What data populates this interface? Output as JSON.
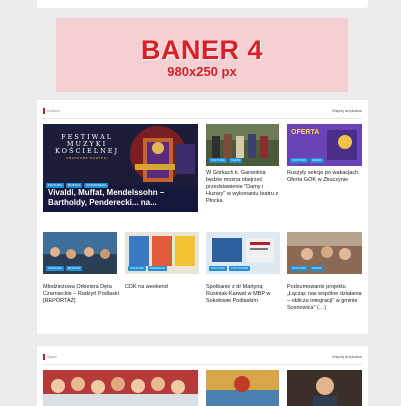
{
  "banner": {
    "title": "BANER 4",
    "size": "980x250 px"
  },
  "section1": {
    "label": "Kultura",
    "more": "Więcej artykułów"
  },
  "feature": {
    "title": "Vivaldi, Muffat, Mendelssohn – Bartholdy, Penderecki... na...",
    "poster_line1": "FESTIWAL",
    "poster_line2": "MUZYKI",
    "poster_line3": "KOŚCIELNEJ",
    "poster_sub": "GRZEGORZ NOWICKI",
    "badges": [
      "KULTURA",
      "MUZYKA",
      "WYDARZENIA"
    ]
  },
  "side_articles": [
    {
      "title": "W Górkach k. Garwolina będzie można obejrzeć przedstawienie \"Damy i Huzary\" w wykonaniu teatru z Płocka",
      "badges": [
        "KULTURA",
        "TEATR"
      ]
    },
    {
      "title": "Ruszyły sekcje po wakacjach. Oferta GOK w Zbuczynie",
      "badges": [
        "KULTURA",
        "GMINA"
      ],
      "poster": "OFERTA"
    }
  ],
  "row_articles": [
    {
      "title": "Młodzieżowa Orkiestra Dęta Czarnieckie – Radzyń Podlaski [REPORTAŻ]",
      "badges": [
        "KULTURA",
        "MUZYKA"
      ]
    },
    {
      "title": "CDK na weekend",
      "badges": [
        "KULTURA",
        "WEEKEND"
      ]
    },
    {
      "title": "Spotkanie z dr Martyną Rusiniak-Karwat w MBP w Sokołowie Podlaskim",
      "badges": [
        "KULTURA",
        "SPOTKANIE"
      ]
    },
    {
      "title": "Podsumowanie projektu „Łącząc nas wspólne działania – oblicza integracji\" w gminie Sosnowica\" (…)",
      "badges": [
        "KULTURA",
        "GMINA"
      ]
    }
  ],
  "section2": {
    "label": "Sport",
    "more": "Więcej artykułów"
  },
  "colors": {
    "banner_bg": "#f4cfd3",
    "banner_text": "#d92027",
    "badge": "#1f8fd6",
    "accent": "#b31e2a"
  }
}
